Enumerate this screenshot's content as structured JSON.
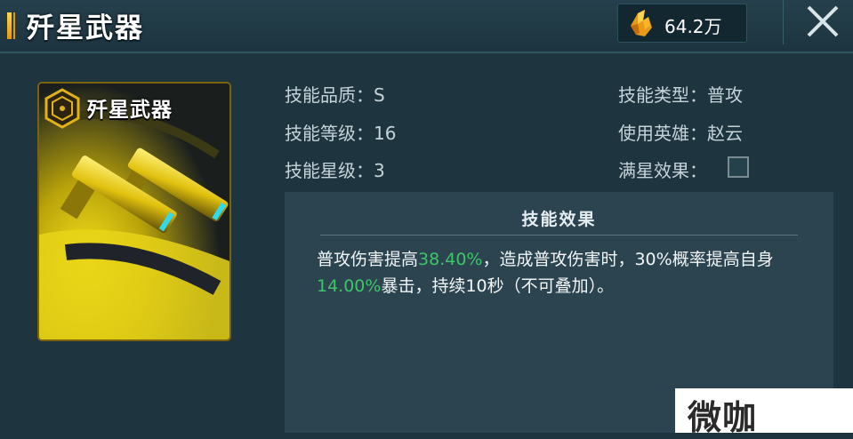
{
  "header": {
    "title": "歼星武器",
    "currency_value": "64.2万",
    "currency_icon": "crystal-icon",
    "close_icon": "close-icon"
  },
  "card": {
    "title": "歼星武器",
    "badge_icon": "hexagon-badge-icon",
    "art": "dual-gold-pistols-image"
  },
  "info": {
    "quality_label": "技能品质：",
    "quality_value": "S",
    "level_label": "技能等级：",
    "level_value": "16",
    "star_label": "技能星级：",
    "star_value": "3",
    "type_label": "技能类型：",
    "type_value": "普攻",
    "hero_label": "使用英雄：",
    "hero_value": "赵云",
    "full_star_label": "满星效果："
  },
  "effect": {
    "title": "技能效果",
    "part1": "普攻伤害提高",
    "value1": "38.40%",
    "part2": "，造成普攻伤害时，30%概率提高自身",
    "value2": "14.00%",
    "part3": "暴击，持续10秒（不可叠加）。"
  },
  "watermark": {
    "text": "微咖"
  },
  "colors": {
    "background": "#1e3540",
    "panel": "#2b4450",
    "highlight": "#3ec56a",
    "gold": "#e3b215"
  }
}
